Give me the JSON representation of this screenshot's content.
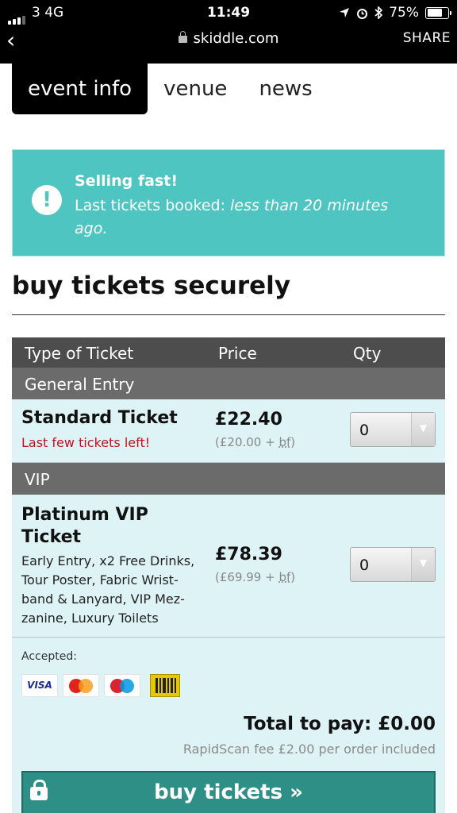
{
  "status_bar": {
    "carrier": "3  4G",
    "time": "11:49",
    "battery": "75%",
    "battery_level": 0.75,
    "icons": [
      "signal-icon",
      "location-icon",
      "alarm-icon",
      "bluetooth-icon",
      "battery-icon"
    ]
  },
  "browser": {
    "url": "skiddle.com",
    "share_label": "SHARE",
    "back_icon": "chevron-left-icon"
  },
  "tabs": [
    {
      "label": "event info",
      "active": true
    },
    {
      "label": "venue",
      "active": false
    },
    {
      "label": "news",
      "active": false
    }
  ],
  "alert": {
    "title": "Selling fast!",
    "text_prefix": "Last tickets booked: ",
    "text_emphasis": "less than 20 minutes ago.",
    "color": "#4ec5c1"
  },
  "heading": "buy tickets securely",
  "table": {
    "headers": {
      "type": "Type of Ticket",
      "price": "Price",
      "qty": "Qty"
    },
    "groups": [
      {
        "label": "General Entry",
        "tickets": [
          {
            "name": "Standard Ticket",
            "note": "Last few tickets left!",
            "price": "£22.40",
            "price_detail_open": "(£20.00 + ",
            "price_detail_fee": "bf",
            "price_detail_close": ")",
            "qty": "0"
          }
        ]
      },
      {
        "label": "VIP",
        "tickets": [
          {
            "name": "Platinum VIP Ticket",
            "description": "Early Entry, x2 Free Drinks, Tour Poster, Fabric Wrist-band & Lanyard, VIP Mez-zanine, Luxury Toilets",
            "price": "£78.39",
            "price_detail_open": "(£69.99 + ",
            "price_detail_fee": "bf",
            "price_detail_close": ")",
            "qty": "0"
          }
        ]
      }
    ]
  },
  "payment": {
    "accepted_label": "Accepted:",
    "cards": [
      "VISA",
      "mastercard",
      "maestro",
      "rapidscan"
    ],
    "total": "Total to pay: £0.00",
    "fee_note": "RapidScan fee £2.00 per order included",
    "buy_label": "buy tickets »"
  },
  "colors": {
    "teal": "#4ec5c1",
    "row_bg": "#ddf3f5",
    "header_bg": "#4d4d4d",
    "button": "#2e8f86",
    "warning_red": "#c0121d"
  }
}
